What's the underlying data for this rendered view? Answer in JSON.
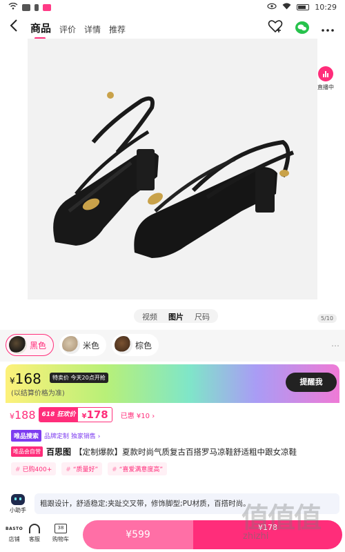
{
  "status_bar": {
    "time": "10:29"
  },
  "nav": {
    "tabs": [
      {
        "label": "商品"
      },
      {
        "label": "评价"
      },
      {
        "label": "详情"
      },
      {
        "label": "推荐"
      }
    ]
  },
  "gallery": {
    "live_label": "直播中",
    "media_tabs": [
      {
        "label": "视频"
      },
      {
        "label": "图片"
      },
      {
        "label": "尺码"
      }
    ],
    "page_indicator": "5/10"
  },
  "colors": [
    {
      "label": "黑色",
      "selected": true
    },
    {
      "label": "米色",
      "selected": false
    },
    {
      "label": "棕色",
      "selected": false
    }
  ],
  "price": {
    "currency": "¥",
    "current": "168",
    "special_tag": "特卖价",
    "special_time": "今天20点开抢",
    "note": "(以结算价格为准)",
    "remind_button": "提醒我",
    "original_currency": "¥",
    "original": "188",
    "sale_tag": "618 狂欢价",
    "sale_currency": "¥",
    "sale_price": "178",
    "saved": "已惠 ¥10 ›"
  },
  "brand": {
    "tag": "唯品搜索",
    "sub": "品牌定制 独家销售 ›"
  },
  "title": {
    "vip_tag": "唯品会自营",
    "brand_name": "百思图",
    "text": "【定制爆款】夏款时尚气质复古百搭罗马凉鞋舒适粗中跟女凉鞋"
  },
  "badges": [
    {
      "label": "已购400+"
    },
    {
      "label": "“质量好”"
    },
    {
      "label": "“喜爱满意度高”"
    }
  ],
  "assistant": {
    "label": "小助手",
    "text": "粗跟设计，舒适稳定;夹趾交叉带，修饰脚型;PU材质，百搭时尚。"
  },
  "bottom_bar": {
    "store_logo": "BASTO",
    "store_label": "店铺",
    "service_label": "客服",
    "cart_label": "购物车",
    "cart_count": "38",
    "left_price": "¥599",
    "right_price": "¥178"
  },
  "watermark": {
    "text": "值值值",
    "sub": "zhizhi"
  }
}
